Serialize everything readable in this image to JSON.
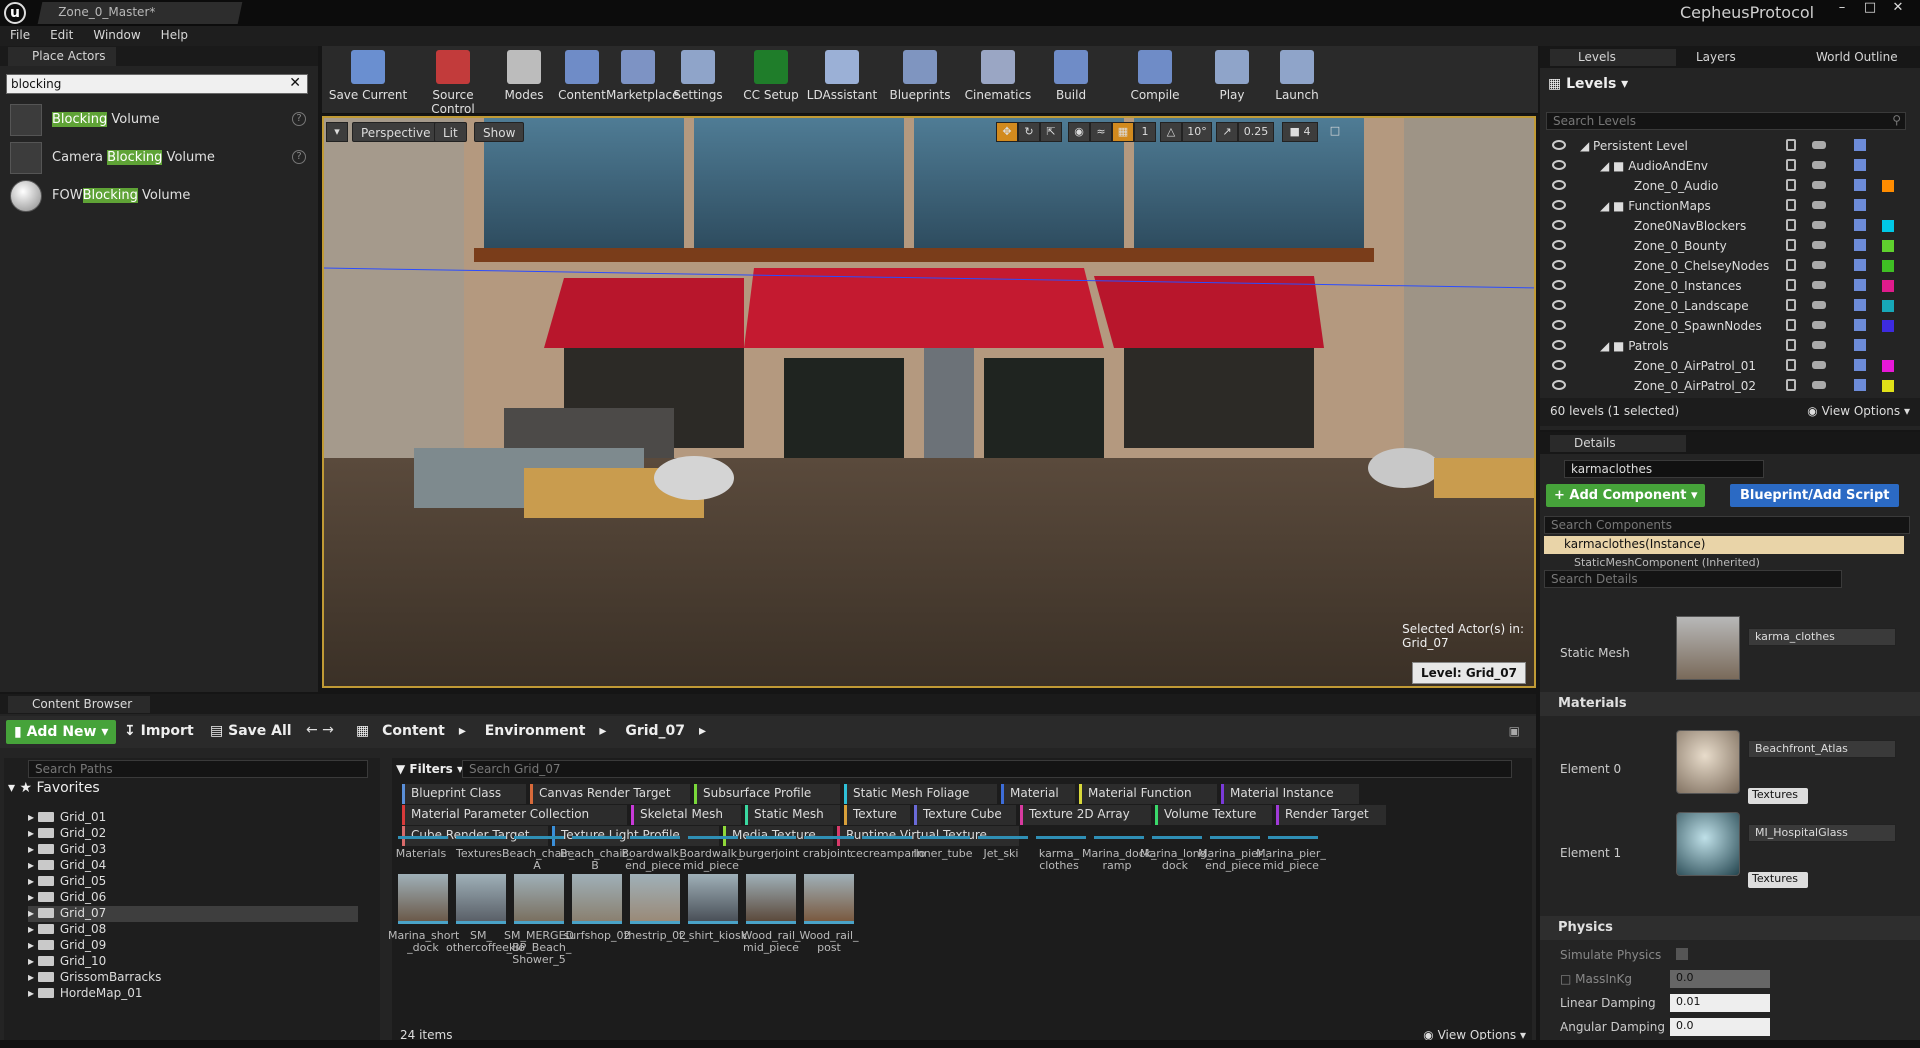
{
  "window": {
    "doc_tab": "Zone_0_Master*",
    "project": "CepheusProtocol",
    "menu": [
      "File",
      "Edit",
      "Window",
      "Help"
    ]
  },
  "place_actors": {
    "tab": "Place Actors",
    "search_value": "blocking",
    "items": [
      {
        "pre": "",
        "match": "Blocking",
        "post": " Volume"
      },
      {
        "pre": "Camera ",
        "match": "Blocking",
        "post": " Volume"
      },
      {
        "pre": "FOW",
        "match": "Blocking",
        "post": " Volume"
      }
    ]
  },
  "toolbar": {
    "buttons": [
      {
        "label": "Save Current",
        "icon": "save-icon",
        "color": "#6a8fd0"
      },
      {
        "label": "Source Control",
        "icon": "source-control-icon",
        "color": "#c23b3b"
      },
      {
        "label": "Modes",
        "icon": "modes-icon",
        "color": "#bcbcbc"
      },
      {
        "label": "Content",
        "icon": "content-icon",
        "color": "#6f8cc7"
      },
      {
        "label": "Marketplace",
        "icon": "marketplace-icon",
        "color": "#7d93c4"
      },
      {
        "label": "Settings",
        "icon": "settings-icon",
        "color": "#8fa4c9"
      },
      {
        "label": "CC Setup",
        "icon": "cc-setup-icon",
        "color": "#1f7d2a"
      },
      {
        "label": "LDAssistant",
        "icon": "ldassistant-icon",
        "color": "#9bb0d6"
      },
      {
        "label": "Blueprints",
        "icon": "blueprints-icon",
        "color": "#7f95c0"
      },
      {
        "label": "Cinematics",
        "icon": "cinematics-icon",
        "color": "#9aa6c4"
      },
      {
        "label": "Build",
        "icon": "build-icon",
        "color": "#6f8cc7"
      },
      {
        "label": "Compile",
        "icon": "compile-icon",
        "color": "#6f8cc7"
      },
      {
        "label": "Play",
        "icon": "play-icon",
        "color": "#8fa4c9"
      },
      {
        "label": "Launch",
        "icon": "launch-icon",
        "color": "#8fa4c9"
      }
    ]
  },
  "viewport": {
    "perspective": "Perspective",
    "lit": "Lit",
    "show": "Show",
    "snap_angle": "10°",
    "snap_scale": "0.25",
    "camera_speed": "4",
    "grid_snap": "1",
    "selected_line1": "Selected Actor(s) in:",
    "selected_line2": "Grid_07",
    "level_label": "Level:  Grid_07"
  },
  "levels": {
    "tabs": [
      "Levels",
      "Layers",
      "World Outline"
    ],
    "title": "Levels",
    "search_placeholder": "Search Levels",
    "rows": [
      {
        "name": "Persistent Level",
        "indent": 0,
        "folder": false,
        "color": "",
        "arrow": true
      },
      {
        "name": "AudioAndEnv",
        "indent": 1,
        "folder": true,
        "color": "",
        "arrow": true
      },
      {
        "name": "Zone_0_Audio",
        "indent": 2,
        "folder": false,
        "color": "#ff8c00",
        "arrow": false
      },
      {
        "name": "FunctionMaps",
        "indent": 1,
        "folder": true,
        "color": "",
        "arrow": true
      },
      {
        "name": "Zone0NavBlockers",
        "indent": 2,
        "folder": false,
        "color": "#00c8e6",
        "arrow": false
      },
      {
        "name": "Zone_0_Bounty",
        "indent": 2,
        "folder": false,
        "color": "#5fd12e",
        "arrow": false
      },
      {
        "name": "Zone_0_ChelseyNodes",
        "indent": 2,
        "folder": false,
        "color": "#3fbf24",
        "arrow": false
      },
      {
        "name": "Zone_0_Instances",
        "indent": 2,
        "folder": false,
        "color": "#e01b8c",
        "arrow": false
      },
      {
        "name": "Zone_0_Landscape",
        "indent": 2,
        "folder": false,
        "color": "#17a8b8",
        "arrow": false
      },
      {
        "name": "Zone_0_SpawnNodes",
        "indent": 2,
        "folder": false,
        "color": "#3d2be0",
        "arrow": false
      },
      {
        "name": "Patrols",
        "indent": 1,
        "folder": true,
        "color": "",
        "arrow": true
      },
      {
        "name": "Zone_0_AirPatrol_01",
        "indent": 2,
        "folder": false,
        "color": "#e818d8",
        "arrow": false
      },
      {
        "name": "Zone_0_AirPatrol_02",
        "indent": 2,
        "folder": false,
        "color": "#e0e018",
        "arrow": false
      }
    ],
    "footer": "60 levels (1 selected)",
    "view_options": "View Options"
  },
  "details": {
    "tab": "Details",
    "actor_name": "karmaclothes",
    "add_component": "+ Add Component",
    "blueprint_script": "Blueprint/Add Script",
    "search_components": "Search Components",
    "instance_row": "karmaclothes(Instance)",
    "inherited_row": "StaticMeshComponent (Inherited)",
    "search_details": "Search Details",
    "static_mesh_label": "Static Mesh",
    "static_mesh_value": "karma_clothes",
    "materials_header": "Materials",
    "element0_label": "Element 0",
    "element0_value": "Beachfront_Atlas",
    "element1_label": "Element 1",
    "element1_value": "MI_HospitalGlass",
    "textures": "Textures",
    "physics_header": "Physics",
    "simulate_physics": "Simulate Physics",
    "mass_kg": "MassInKg",
    "mass_value": "0.0",
    "linear_damping": "Linear Damping",
    "linear_value": "0.01",
    "angular_damping": "Angular Damping",
    "angular_value": "0.0"
  },
  "content_browser": {
    "tab": "Content Browser",
    "add_new": "Add New",
    "import": "Import",
    "save_all": "Save All",
    "breadcrumb": [
      "Content",
      "Environment",
      "Grid_07"
    ],
    "search_paths": "Search Paths",
    "favorites": "Favorites",
    "tree": [
      "Grid_01",
      "Grid_02",
      "Grid_03",
      "Grid_04",
      "Grid_05",
      "Grid_06",
      "Grid_07",
      "Grid_08",
      "Grid_09",
      "Grid_10",
      "GrissomBarracks",
      "HordeMap_01"
    ],
    "selected_tree": "Grid_07",
    "filters": "Filters",
    "search_assets": "Search Grid_07",
    "filter_chips": [
      "Blueprint Class",
      "Canvas Render Target",
      "Subsurface Profile",
      "Static Mesh Foliage",
      "Material",
      "Material Function",
      "Material Instance",
      "Material Parameter Collection",
      "Skeletal Mesh",
      "Static Mesh",
      "Texture",
      "Texture Cube",
      "Texture 2D Array",
      "Volume Texture",
      "Render Target",
      "Cube Render Target",
      "Texture Light Profile",
      "Media Texture",
      "Runtime Virtual Texture"
    ],
    "row1_labels": [
      "Materials",
      "Textures",
      "Beach_chair_\nA",
      "Beach_chair_\nB",
      "Boardwalk_\nend_piece",
      "Boardwalk_\nmid_piece",
      "burgerjoint",
      "crabjoint",
      "cecreamparlo",
      "Inner_tube",
      "Jet_ski",
      "karma_\nclothes",
      "Marina_dock_\nramp",
      "Marina_long_\ndock",
      "Marina_pier_\nend_piece",
      "Marina_pier_\nmid_piece"
    ],
    "row2_labels": [
      "Marina_short\n_dock",
      "SM_\nothercoffeekio",
      "SM_MERGED\n_BP_Beach_\nShower_5",
      "surfshop_02",
      "thestrip_02",
      "t_shirt_kiosk",
      "Wood_rail_\nmid_piece",
      "Wood_rail_\npost"
    ],
    "items_count": "24 items",
    "view_options": "View Options"
  }
}
